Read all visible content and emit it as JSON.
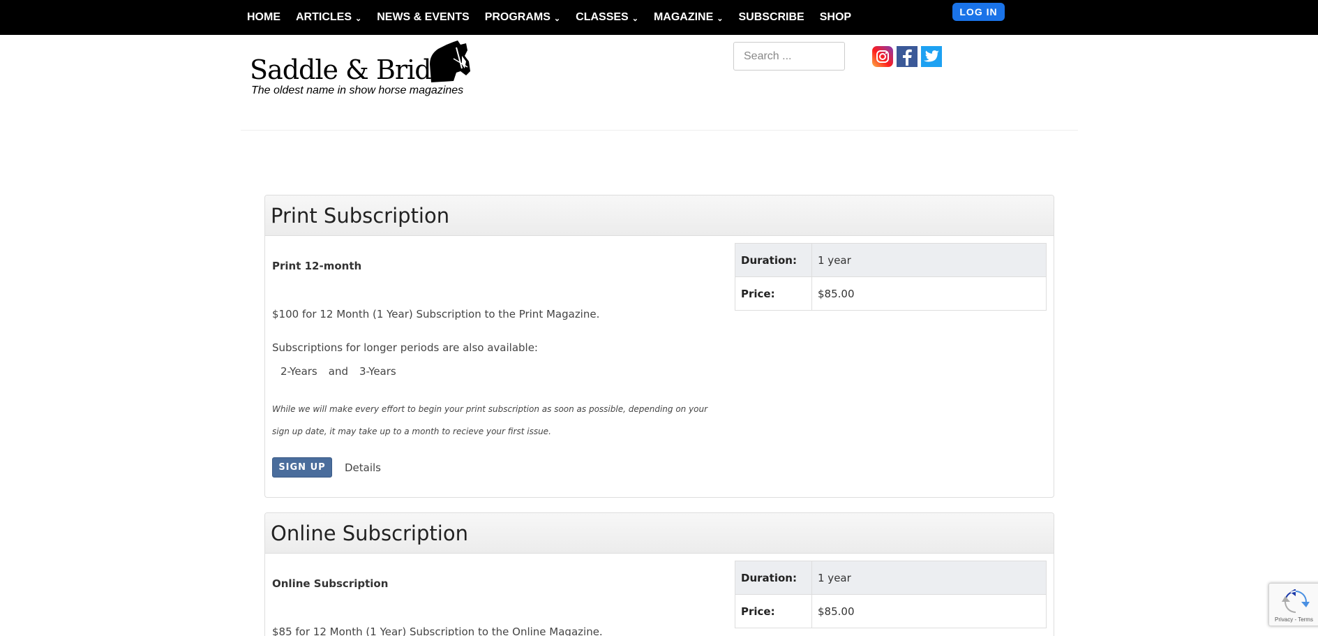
{
  "nav": {
    "items": [
      {
        "label": "HOME",
        "dropdown": false
      },
      {
        "label": "ARTICLES",
        "dropdown": true
      },
      {
        "label": "NEWS & EVENTS",
        "dropdown": false
      },
      {
        "label": "PROGRAMS",
        "dropdown": true
      },
      {
        "label": "CLASSES",
        "dropdown": true
      },
      {
        "label": "MAGAZINE",
        "dropdown": true
      },
      {
        "label": "SUBSCRIBE",
        "dropdown": false
      },
      {
        "label": "SHOP",
        "dropdown": false
      }
    ],
    "login_label": "LOG IN"
  },
  "header": {
    "logo_title": "Saddle & Bridle",
    "logo_tagline": "The oldest name in show horse magazines",
    "search_placeholder": "Search ...",
    "social": [
      "instagram-icon",
      "facebook-icon",
      "twitter-icon"
    ]
  },
  "subscriptions": [
    {
      "title": "Print Subscription",
      "name": "Print 12-month",
      "description": "$100 for 12 Month (1 Year) Subscription to the Print Magazine.",
      "longer_text": "Subscriptions for longer periods are also available:",
      "periods": [
        "2-Years",
        "and",
        "3-Years"
      ],
      "note": "While we will make every effort to begin your print subscription as soon as possible, depending on your sign up date, it may take up to a month to recieve your first issue.",
      "signup_label": "SIGN UP",
      "details_label": "Details",
      "duration_label": "Duration:",
      "duration_value": "1 year",
      "price_label": "Price:",
      "price_value": "$85.00"
    },
    {
      "title": "Online Subscription",
      "name": "Online Subscription",
      "description": "$85 for 12 Month (1 Year) Subscription to the Online Magazine.",
      "duration_label": "Duration:",
      "duration_value": "1 year",
      "price_label": "Price:",
      "price_value": "$85.00"
    }
  ],
  "recaptcha": {
    "text": "Privacy - Terms"
  },
  "colors": {
    "nav_bg": "#000000",
    "login_bg": "#1a73e8",
    "signup_bg": "#4a6d9c"
  }
}
